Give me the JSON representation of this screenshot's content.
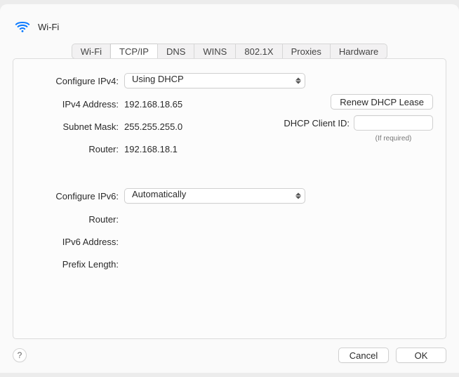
{
  "title": "Wi-Fi",
  "tabs": {
    "wifi": "Wi-Fi",
    "tcpip": "TCP/IP",
    "dns": "DNS",
    "wins": "WINS",
    "8021x": "802.1X",
    "proxies": "Proxies",
    "hardware": "Hardware"
  },
  "labels": {
    "configure_ipv4": "Configure IPv4:",
    "ipv4_address": "IPv4 Address:",
    "subnet_mask": "Subnet Mask:",
    "router_v4": "Router:",
    "configure_ipv6": "Configure IPv6:",
    "router_v6": "Router:",
    "ipv6_address": "IPv6 Address:",
    "prefix_length": "Prefix Length:",
    "dhcp_client_id": "DHCP Client ID:",
    "if_required": "(If required)"
  },
  "values": {
    "configure_ipv4": "Using DHCP",
    "ipv4_address": "192.168.18.65",
    "subnet_mask": "255.255.255.0",
    "router_v4": "192.168.18.1",
    "configure_ipv6": "Automatically",
    "router_v6": "",
    "ipv6_address": "",
    "prefix_length": "",
    "dhcp_client_id": ""
  },
  "buttons": {
    "renew_dhcp": "Renew DHCP Lease",
    "cancel": "Cancel",
    "ok": "OK",
    "help": "?"
  }
}
